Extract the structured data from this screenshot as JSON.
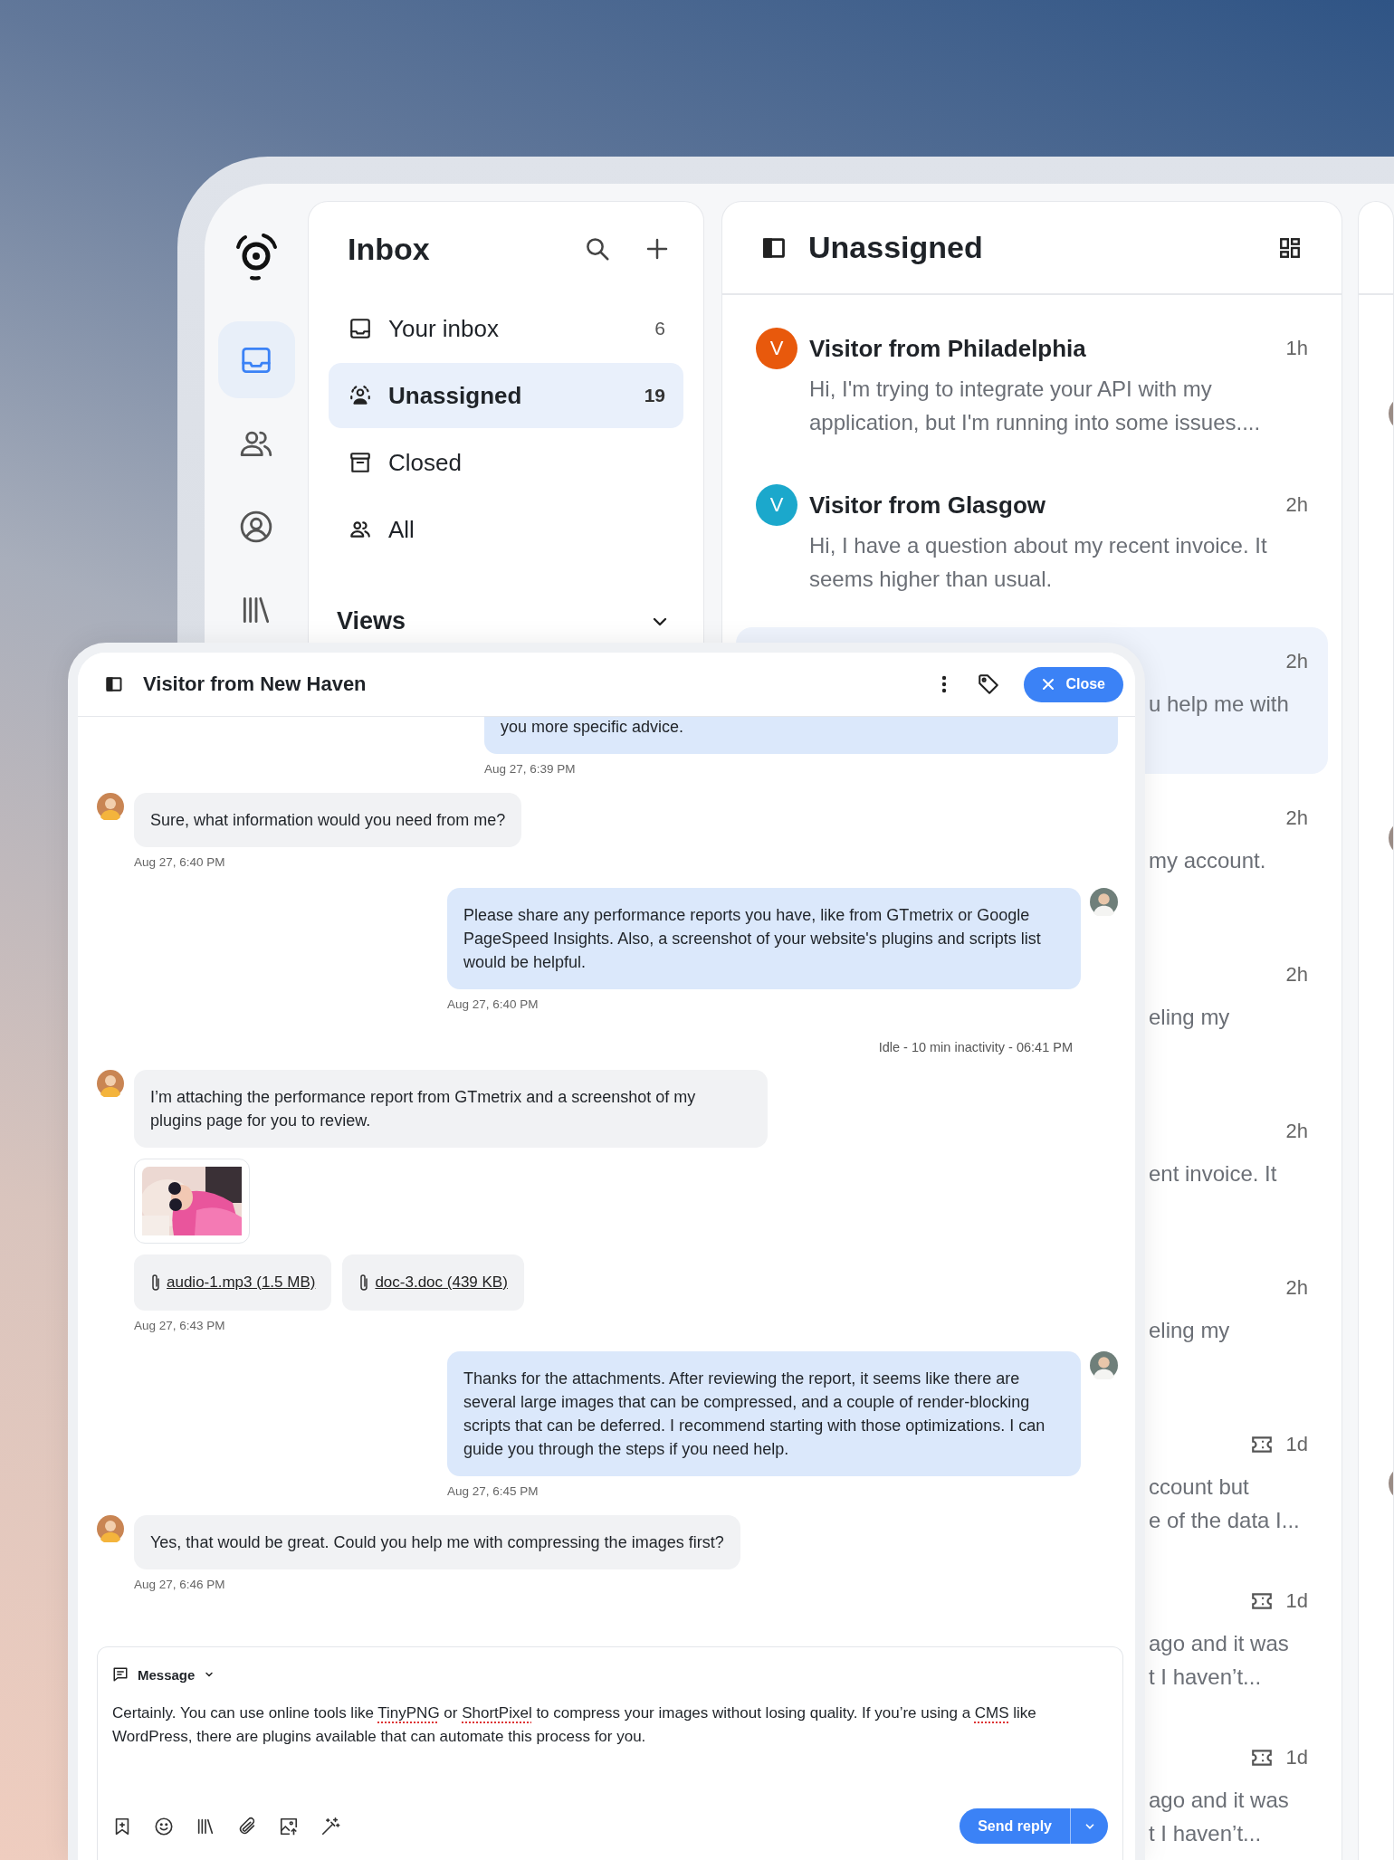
{
  "sidebar": {
    "items": [
      {
        "kind": "inbox",
        "selected": true
      },
      {
        "kind": "contacts",
        "selected": false
      },
      {
        "kind": "profile",
        "selected": false
      },
      {
        "kind": "library",
        "selected": false
      }
    ]
  },
  "inbox": {
    "title": "Inbox",
    "folders": [
      {
        "kind": "tray",
        "label": "Your inbox",
        "count": "6",
        "selected": false
      },
      {
        "kind": "unassigned",
        "label": "Unassigned",
        "count": "19",
        "selected": true
      },
      {
        "kind": "archive",
        "label": "Closed",
        "selected": false
      },
      {
        "kind": "team",
        "label": "All",
        "selected": false
      }
    ],
    "views_label": "Views"
  },
  "conversations": {
    "title": "Unassigned",
    "items": [
      {
        "kind": "full",
        "letter": "V",
        "color": "#e8590c",
        "name": "Visitor from Philadelphia",
        "time": "1h",
        "ticket": false,
        "preview": "Hi, I'm trying to integrate your API with my application, but I'm running into some issues....",
        "selected": false
      },
      {
        "kind": "full",
        "letter": "V",
        "color": "#1ba8cc",
        "name": "Visitor from Glasgow",
        "time": "2h",
        "ticket": false,
        "preview": "Hi, I have a question about my recent invoice. It seems higher than usual.",
        "selected": false
      },
      {
        "kind": "covered",
        "time": "2h",
        "ticket": false,
        "preview_lines": [
          "u help me with"
        ],
        "selected": true
      },
      {
        "kind": "covered",
        "time": "2h",
        "ticket": false,
        "preview_lines": [
          "my account."
        ],
        "selected": false
      },
      {
        "kind": "covered",
        "time": "2h",
        "ticket": false,
        "preview_lines": [
          "eling my"
        ],
        "selected": false
      },
      {
        "kind": "covered",
        "time": "2h",
        "ticket": false,
        "preview_lines": [
          "ent invoice. It"
        ],
        "selected": false
      },
      {
        "kind": "covered",
        "time": "2h",
        "ticket": false,
        "preview_lines": [
          "eling my"
        ],
        "selected": false
      },
      {
        "kind": "covered",
        "time": "1d",
        "ticket": true,
        "preview_lines": [
          "ccount but",
          "e of the data I..."
        ],
        "selected": false
      },
      {
        "kind": "covered",
        "time": "1d",
        "ticket": true,
        "preview_lines": [
          "ago and it was",
          "t I haven’t..."
        ],
        "selected": false
      },
      {
        "kind": "covered",
        "time": "1d",
        "ticket": true,
        "preview_lines": [
          "ago and it was",
          "t I haven’t..."
        ],
        "selected": false
      }
    ]
  },
  "chat": {
    "title": "Visitor from New Haven",
    "close_label": "Close",
    "messages": [
      {
        "kind": "agent",
        "cut": true,
        "text": "you more specific advice.",
        "time": "Aug 27, 6:39 PM"
      },
      {
        "kind": "customer",
        "text": "Sure, what information would you need from me?",
        "time": "Aug 27, 6:40 PM"
      },
      {
        "kind": "agent",
        "text": "Please share any performance reports you have, like from GTmetrix or Google PageSpeed Insights. Also, a screenshot of your website's plugins and scripts list would be helpful.",
        "time": "Aug 27, 6:40 PM"
      },
      {
        "kind": "event",
        "text": "Idle - 10 min inactivity - 06:41 PM"
      },
      {
        "kind": "customer",
        "text": "I’m attaching the performance report from GTmetrix and a screenshot of my plugins page for you to review.",
        "attachments": [
          {
            "kind": "picture"
          },
          {
            "kind": "file",
            "name": "audio-1.mp3 (1.5 MB)"
          },
          {
            "kind": "file",
            "name": "doc-3.doc (439 KB)"
          }
        ],
        "time": "Aug 27, 6:43 PM"
      },
      {
        "kind": "agent",
        "text": "Thanks for the attachments. After reviewing the report, it seems like there are several large images that can be compressed, and a couple of render-blocking scripts that can be deferred. I recommend starting with those optimizations. I can guide you through the steps if you need help.",
        "time": "Aug 27, 6:45 PM"
      },
      {
        "kind": "customer",
        "text": "Yes, that would be great. Could you help me with compressing the images first?",
        "time": "Aug 27, 6:46 PM"
      }
    ],
    "composer": {
      "mode": "Message",
      "send_label": "Send reply",
      "draft": [
        {
          "text": "Certainly. You can use online tools like ",
          "misspelled": false
        },
        {
          "text": "TinyPNG",
          "misspelled": true
        },
        {
          "text": " or ",
          "misspelled": false
        },
        {
          "text": "ShortPixel",
          "misspelled": true
        },
        {
          "text": " to compress your images without losing quality. If you’re using a ",
          "misspelled": false
        },
        {
          "text": "CMS",
          "misspelled": true
        },
        {
          "text": " like WordPress, there are plugins available that can automate this process for you.",
          "misspelled": false
        }
      ]
    }
  }
}
